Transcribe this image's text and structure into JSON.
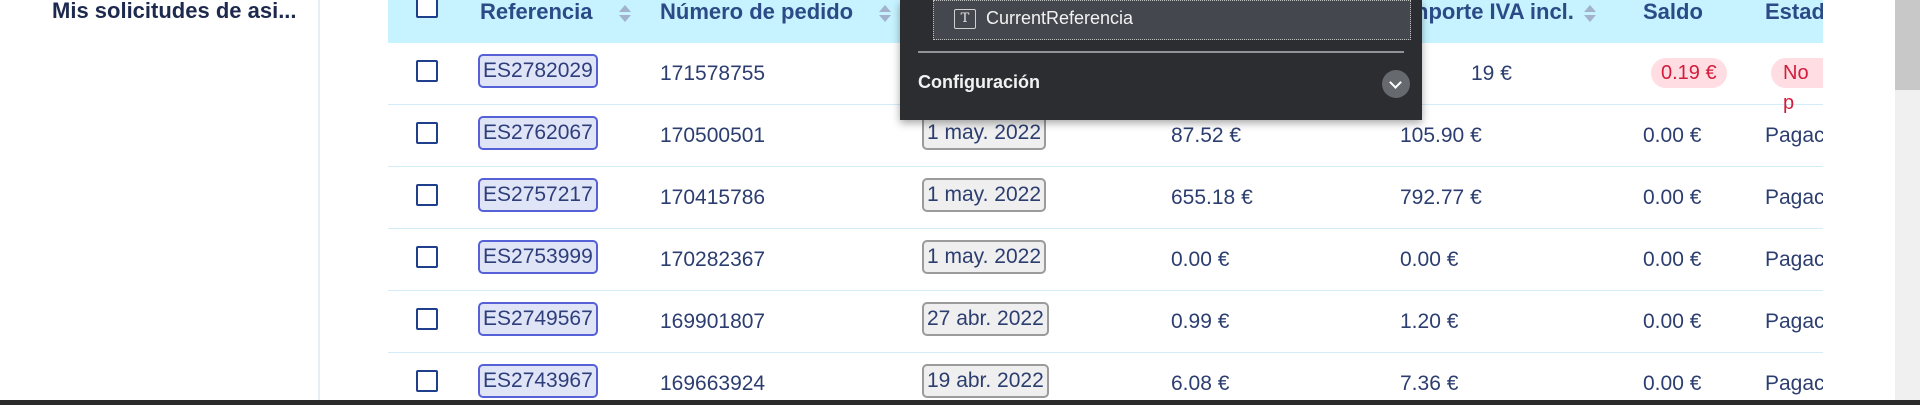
{
  "sidebar": {
    "link_label": "Mis solicitudes de asi..."
  },
  "table": {
    "headers": {
      "reference": "Referencia",
      "order_number": "Número de pedido",
      "amount_vat": "nporte IVA incl.",
      "balance": "Saldo",
      "status": "Estad"
    },
    "rows": [
      {
        "ref": "ES2782029",
        "order": "171578755",
        "date": "",
        "amount": "",
        "amount_vat": "19 €",
        "balance": "0.19 €",
        "status": "No p"
      },
      {
        "ref": "ES2762067",
        "order": "170500501",
        "date": "1 may. 2022",
        "amount": "87.52 €",
        "amount_vat": "105.90 €",
        "balance": "0.00 €",
        "status": "Pagac"
      },
      {
        "ref": "ES2757217",
        "order": "170415786",
        "date": "1 may. 2022",
        "amount": "655.18 €",
        "amount_vat": "792.77 €",
        "balance": "0.00 €",
        "status": "Pagac"
      },
      {
        "ref": "ES2753999",
        "order": "170282367",
        "date": "1 may. 2022",
        "amount": "0.00 €",
        "amount_vat": "0.00 €",
        "balance": "0.00 €",
        "status": "Pagac"
      },
      {
        "ref": "ES2749567",
        "order": "169901807",
        "date": "27 abr. 2022",
        "amount": "0.99 €",
        "amount_vat": "1.20 €",
        "balance": "0.00 €",
        "status": "Pagac"
      },
      {
        "ref": "ES2743967",
        "order": "169663924",
        "date": "19 abr. 2022",
        "amount": "6.08 €",
        "amount_vat": "7.36 €",
        "balance": "0.00 €",
        "status": "Pagac"
      }
    ]
  },
  "popup": {
    "field_label": "CurrentReferencia",
    "field_icon": "text-field-icon",
    "config_label": "Configuración"
  },
  "colors": {
    "header_bg": "#c6f3ff",
    "ref_chip_border": "#5661d8",
    "badge_bg": "#ffdde3",
    "badge_text": "#d11c3b",
    "popup_bg": "#2b2d31"
  }
}
